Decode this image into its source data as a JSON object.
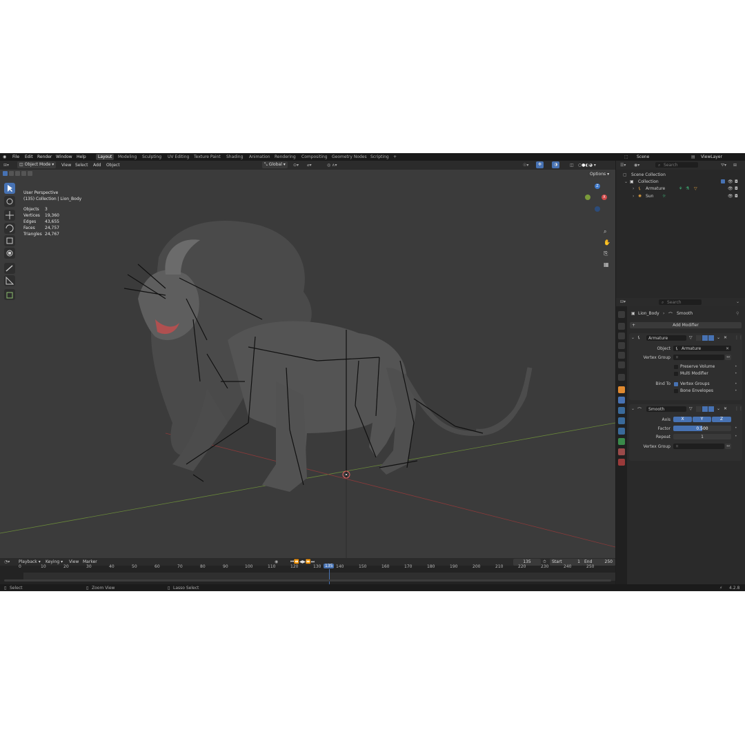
{
  "menu": [
    "File",
    "Edit",
    "Render",
    "Window",
    "Help"
  ],
  "workspaces": [
    "Layout",
    "Modeling",
    "Sculpting",
    "UV Editing",
    "Texture Paint",
    "Shading",
    "Animation",
    "Rendering",
    "Compositing",
    "Geometry Nodes",
    "Scripting"
  ],
  "workspace_add": "+",
  "scene": {
    "label": "Scene",
    "viewlayer": "ViewLayer"
  },
  "viewport_header": {
    "mode": "Object Mode",
    "view": "View",
    "select": "Select",
    "add": "Add",
    "object": "Object",
    "transform": "Global",
    "options": "Options"
  },
  "overlay_info": {
    "perspective": "User Perspective",
    "collection": "(135) Collection | Lion_Body",
    "stats": [
      {
        "label": "Objects",
        "value": "3"
      },
      {
        "label": "Vertices",
        "value": "19,360"
      },
      {
        "label": "Edges",
        "value": "43,655"
      },
      {
        "label": "Faces",
        "value": "24,757"
      },
      {
        "label": "Triangles",
        "value": "24,767"
      }
    ]
  },
  "gizmo": {
    "x": "X",
    "y": "Y",
    "z": "Z"
  },
  "timeline": {
    "playback": "Playback",
    "keying": "Keying",
    "view": "View",
    "marker": "Marker",
    "current_frame": "135",
    "start_label": "Start",
    "start": "1",
    "end_label": "End",
    "end": "250",
    "ticks": [
      "0",
      "10",
      "20",
      "30",
      "40",
      "50",
      "60",
      "70",
      "80",
      "90",
      "100",
      "110",
      "120",
      "130",
      "135",
      "140",
      "150",
      "160",
      "170",
      "180",
      "190",
      "200",
      "210",
      "220",
      "230",
      "240",
      "250"
    ]
  },
  "statusbar": {
    "select": "Select",
    "zoom": "Zoom View",
    "lasso": "Lasso Select",
    "version": "4.2.8"
  },
  "outliner": {
    "search_placeholder": "Search",
    "scene_collection": "Scene Collection",
    "collection": "Collection",
    "items": [
      "Armature",
      "Sun"
    ]
  },
  "properties": {
    "search_placeholder": "Search",
    "breadcrumb_object": "Lion_Body",
    "breadcrumb_modifier": "Smooth",
    "add_modifier": "Add Modifier",
    "armature_mod": {
      "name": "Armature",
      "object_label": "Object",
      "object_value": "Armature",
      "vgroup_label": "Vertex Group",
      "preserve": "Preserve Volume",
      "multi": "Multi Modifier",
      "bind_label": "Bind To",
      "vgroups": "Vertex Groups",
      "envelopes": "Bone Envelopes"
    },
    "smooth_mod": {
      "name": "Smooth",
      "axis_label": "Axis",
      "x": "X",
      "y": "Y",
      "z": "Z",
      "factor_label": "Factor",
      "factor": "0.500",
      "repeat_label": "Repeat",
      "repeat": "1",
      "vgroup_label": "Vertex Group"
    }
  },
  "colors": {
    "accent": "#4772b3",
    "viewport": "#3b3b3b",
    "panel": "#2a2a2a"
  }
}
